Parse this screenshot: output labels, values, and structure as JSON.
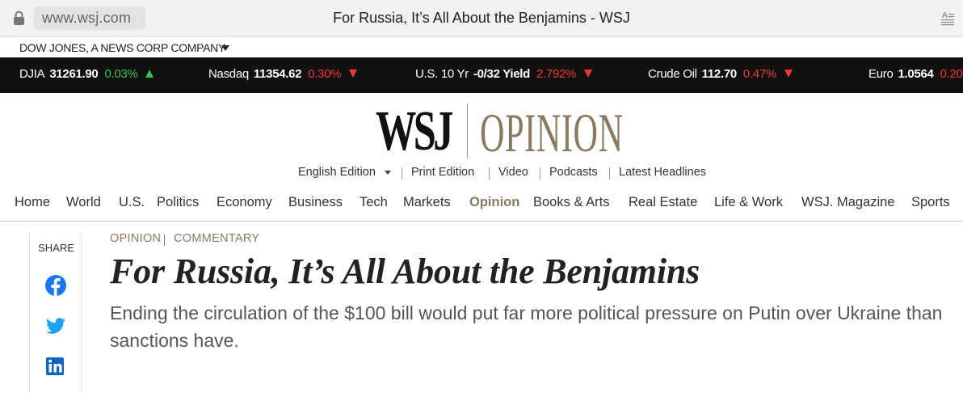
{
  "browser": {
    "url": "www.wsj.com",
    "tab_title": "For Russia, It’s All About the Benjamins - WSJ"
  },
  "dow_jones": {
    "label": "DOW JONES, A NEWS CORP COMPANY"
  },
  "ticker": [
    {
      "name": "DJIA",
      "value": "31261.90",
      "change": "0.03%",
      "direction": "up"
    },
    {
      "name": "Nasdaq",
      "value": "11354.62",
      "change": "0.30%",
      "direction": "down"
    },
    {
      "name": "U.S. 10 Yr",
      "value": "-0/32 Yield",
      "change": "2.792%",
      "direction": "down"
    },
    {
      "name": "Crude Oil",
      "value": "112.70",
      "change": "0.47%",
      "direction": "down"
    },
    {
      "name": "Euro",
      "value": "1.0564",
      "change": "0.20",
      "direction": "down"
    }
  ],
  "masthead": {
    "logo": "WSJ",
    "section": "OPINION"
  },
  "edition_bar": {
    "edition": "English Edition",
    "print": "Print Edition",
    "video": "Video",
    "podcasts": "Podcasts",
    "latest": "Latest Headlines"
  },
  "nav": [
    "Home",
    "World",
    "U.S.",
    "Politics",
    "Economy",
    "Business",
    "Tech",
    "Markets",
    "Opinion",
    "Books & Arts",
    "Real Estate",
    "Life & Work",
    "WSJ. Magazine",
    "Sports"
  ],
  "share": {
    "label": "SHARE"
  },
  "article": {
    "flash_primary": "OPINION",
    "flash_secondary": "COMMENTARY",
    "headline": "For Russia, It’s All About the Benjamins",
    "dek": "Ending the circulation of the $100 bill would put far more political pressure on Putin over Ukraine than sanctions have."
  },
  "colors": {
    "opinion_accent": "#8a7a61",
    "ticker_bg": "#111111",
    "up": "#3fbf4f",
    "down": "#f0383a",
    "facebook": "#1877f2",
    "twitter": "#1da1f2",
    "linkedin": "#0a66c2"
  }
}
